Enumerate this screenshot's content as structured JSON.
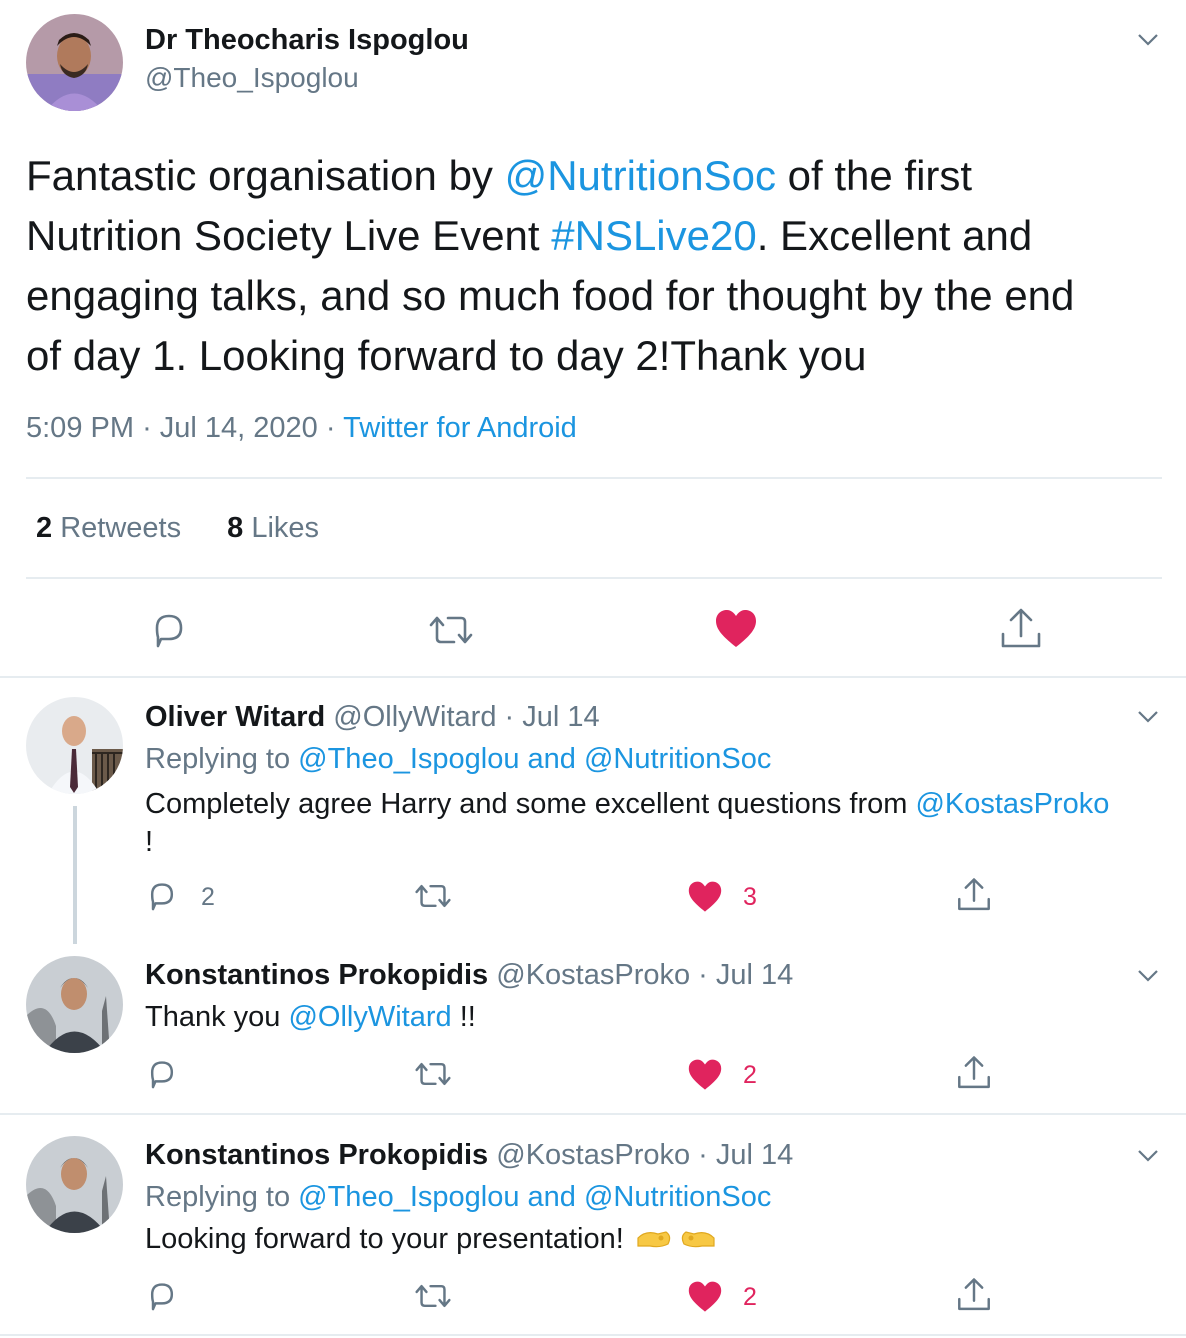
{
  "colors": {
    "accent": "#1b95e0",
    "like": "#e0245e",
    "secondary": "#657786",
    "divider": "#e6ecf0"
  },
  "main_tweet": {
    "author_name": "Dr Theocharis Ispoglou",
    "handle": "@Theo_Ispoglou",
    "text": {
      "t1": "Fantastic organisation by ",
      "m1": "@NutritionSoc",
      "t2": " of the first",
      "t3": "Nutrition Society Live Event ",
      "m2": "#NSLive20",
      "t4": ". Excellent and",
      "t5": "engaging talks, and so much food for thought by the end",
      "t6": "of day 1. Looking forward to day 2!Thank you"
    },
    "time": "5:09 PM",
    "date": "Jul 14, 2020",
    "separator": "·",
    "source": "Twitter for Android",
    "retweets_count": "2",
    "retweets_label": "Retweets",
    "likes_count": "8",
    "likes_label": "Likes",
    "action_icons": [
      "reply-icon",
      "retweet-icon",
      "heart-icon-liked",
      "share-icon"
    ]
  },
  "replies": [
    {
      "author_name": "Oliver Witard",
      "handle": "@OllyWitard",
      "date": "Jul 14",
      "replying_prefix": "Replying to",
      "replying_to_1": "@Theo_Ispoglou",
      "replying_and": "and",
      "replying_to_2": "@NutritionSoc",
      "text_1": "Completely agree Harry and some excellent questions from ",
      "mention": "@KostasProko",
      "text_2": "!",
      "reply_count": "2",
      "like_count": "3"
    },
    {
      "author_name": "Konstantinos Prokopidis",
      "handle": "@KostasProko",
      "date": "Jul 14",
      "text_1": "Thank you ",
      "mention": "@OllyWitard",
      "text_2": " !!",
      "like_count": "2"
    },
    {
      "author_name": "Konstantinos Prokopidis",
      "handle": "@KostasProko",
      "date": "Jul 14",
      "replying_prefix": "Replying to",
      "replying_to_1": "@Theo_Ispoglou",
      "replying_and": "and",
      "replying_to_2": "@NutritionSoc",
      "text_1": "Looking forward to your presentation!",
      "emoji": "flexed-biceps-emoji",
      "like_count": "2"
    }
  ]
}
